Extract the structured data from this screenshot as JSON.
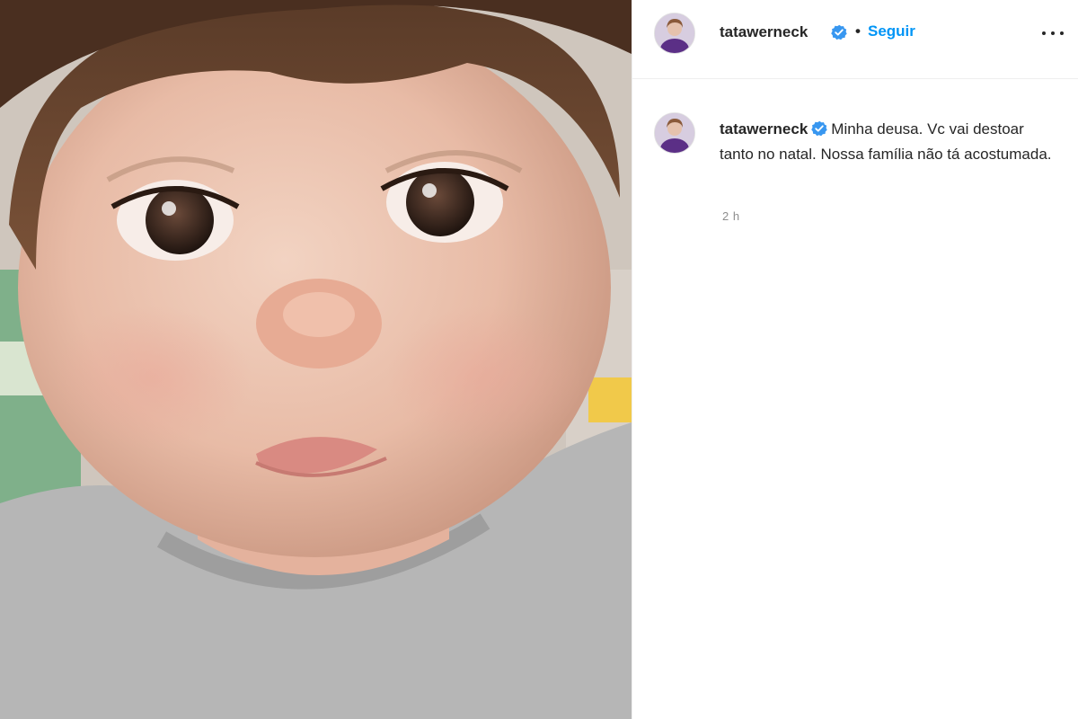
{
  "post": {
    "image_alt": "Close-up photo of a baby",
    "header": {
      "username": "tatawerneck",
      "separator": "•",
      "follow_label": "Seguir",
      "more_icon": "more-options-icon"
    },
    "caption": {
      "username": "tatawerneck",
      "text": "Minha deusa. Vc vai destoar tanto no natal. Nossa família não tá acostumada.",
      "time": "2 h"
    }
  },
  "colors": {
    "link": "#0095f6",
    "verified": "#3897f0",
    "muted": "#8e8e8e"
  }
}
